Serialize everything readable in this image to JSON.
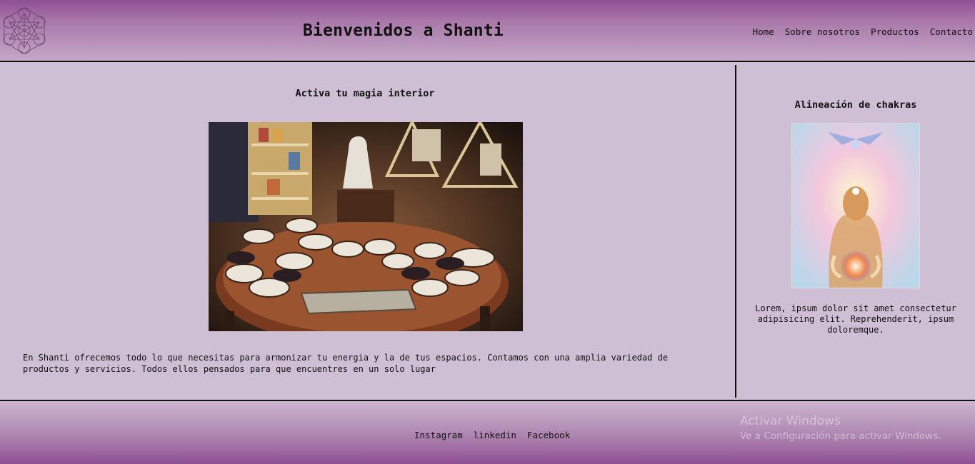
{
  "header": {
    "logo_icon": "metatron-cube-icon",
    "title": "Bienvenidos a Shanti",
    "nav": [
      {
        "label": "Home"
      },
      {
        "label": "Sobre nosotros"
      },
      {
        "label": "Productos"
      },
      {
        "label": "Contacto"
      }
    ]
  },
  "main": {
    "title": "Activa tu magia interior",
    "photo": "shop-table-crystals-photo",
    "text": "En Shanti ofrecemos todo lo que necesitas para armonizar tu energia y la de tus espacios. Contamos con una amplia variedad de productos y servicios. Todos ellos pensados para que encuentres en un solo lugar"
  },
  "aside": {
    "title": "Alineación de chakras",
    "image": "chakra-meditation-image",
    "text": "Lorem, ipsum dolor sit amet consectetur adipisicing elit. Reprehenderit, ipsum doloremque."
  },
  "footer": {
    "links": [
      {
        "label": "Instagram"
      },
      {
        "label": "linkedin"
      },
      {
        "label": "Facebook"
      }
    ],
    "watermark": {
      "title": "Activar Windows",
      "subtitle": "Ve a Configuración para activar Windows."
    }
  },
  "colors": {
    "header_top": "#8f4f94",
    "background": "#cfbfd4"
  }
}
